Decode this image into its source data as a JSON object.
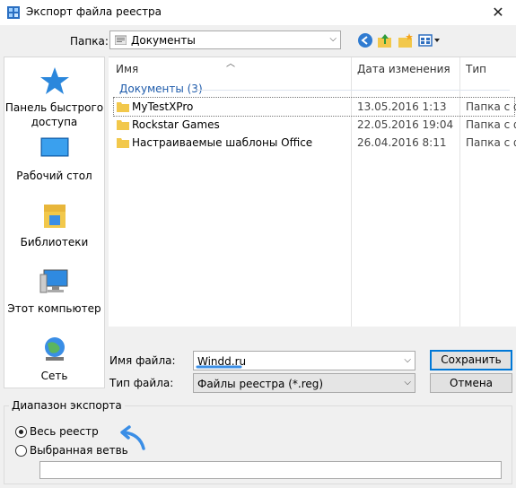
{
  "window": {
    "title": "Экспорт файла реестра",
    "close_glyph": "✕"
  },
  "toolbar": {
    "folder_label": "Папка:",
    "folder_value": "Документы",
    "icons": [
      "back-icon",
      "up-folder-icon",
      "new-folder-icon",
      "view-menu-icon"
    ]
  },
  "places": [
    {
      "label": "Панель быстрого доступа",
      "icon": "star-icon"
    },
    {
      "label": "Рабочий стол",
      "icon": "desktop-icon"
    },
    {
      "label": "Библиотеки",
      "icon": "libraries-icon"
    },
    {
      "label": "Этот компьютер",
      "icon": "computer-icon"
    },
    {
      "label": "Сеть",
      "icon": "network-icon"
    }
  ],
  "filelist": {
    "columns": [
      "Имя",
      "Дата изменения",
      "Тип"
    ],
    "group": "Документы (3)",
    "rows": [
      {
        "name": "MyTestXPro",
        "date": "13.05.2016 1:13",
        "type": "Папка с ф"
      },
      {
        "name": "Rockstar Games",
        "date": "22.05.2016 19:04",
        "type": "Папка с ф"
      },
      {
        "name": "Настраиваемые шаблоны Office",
        "date": "26.04.2016 8:11",
        "type": "Папка с ф"
      }
    ]
  },
  "form": {
    "filename_label": "Имя файла:",
    "filename_value": "Windd.ru",
    "filetype_label": "Тип файла:",
    "filetype_value": "Файлы реестра (*.reg)",
    "save_label": "Сохранить",
    "cancel_label": "Отмена"
  },
  "export_range": {
    "legend": "Диапазон экспорта",
    "options": [
      "Весь реестр",
      "Выбранная ветвь"
    ],
    "selected": "Весь реестр",
    "branch_value": ""
  },
  "colors": {
    "accent": "#0078d7",
    "annotation": "#3a8ee6",
    "group_text": "#1e5bab"
  }
}
